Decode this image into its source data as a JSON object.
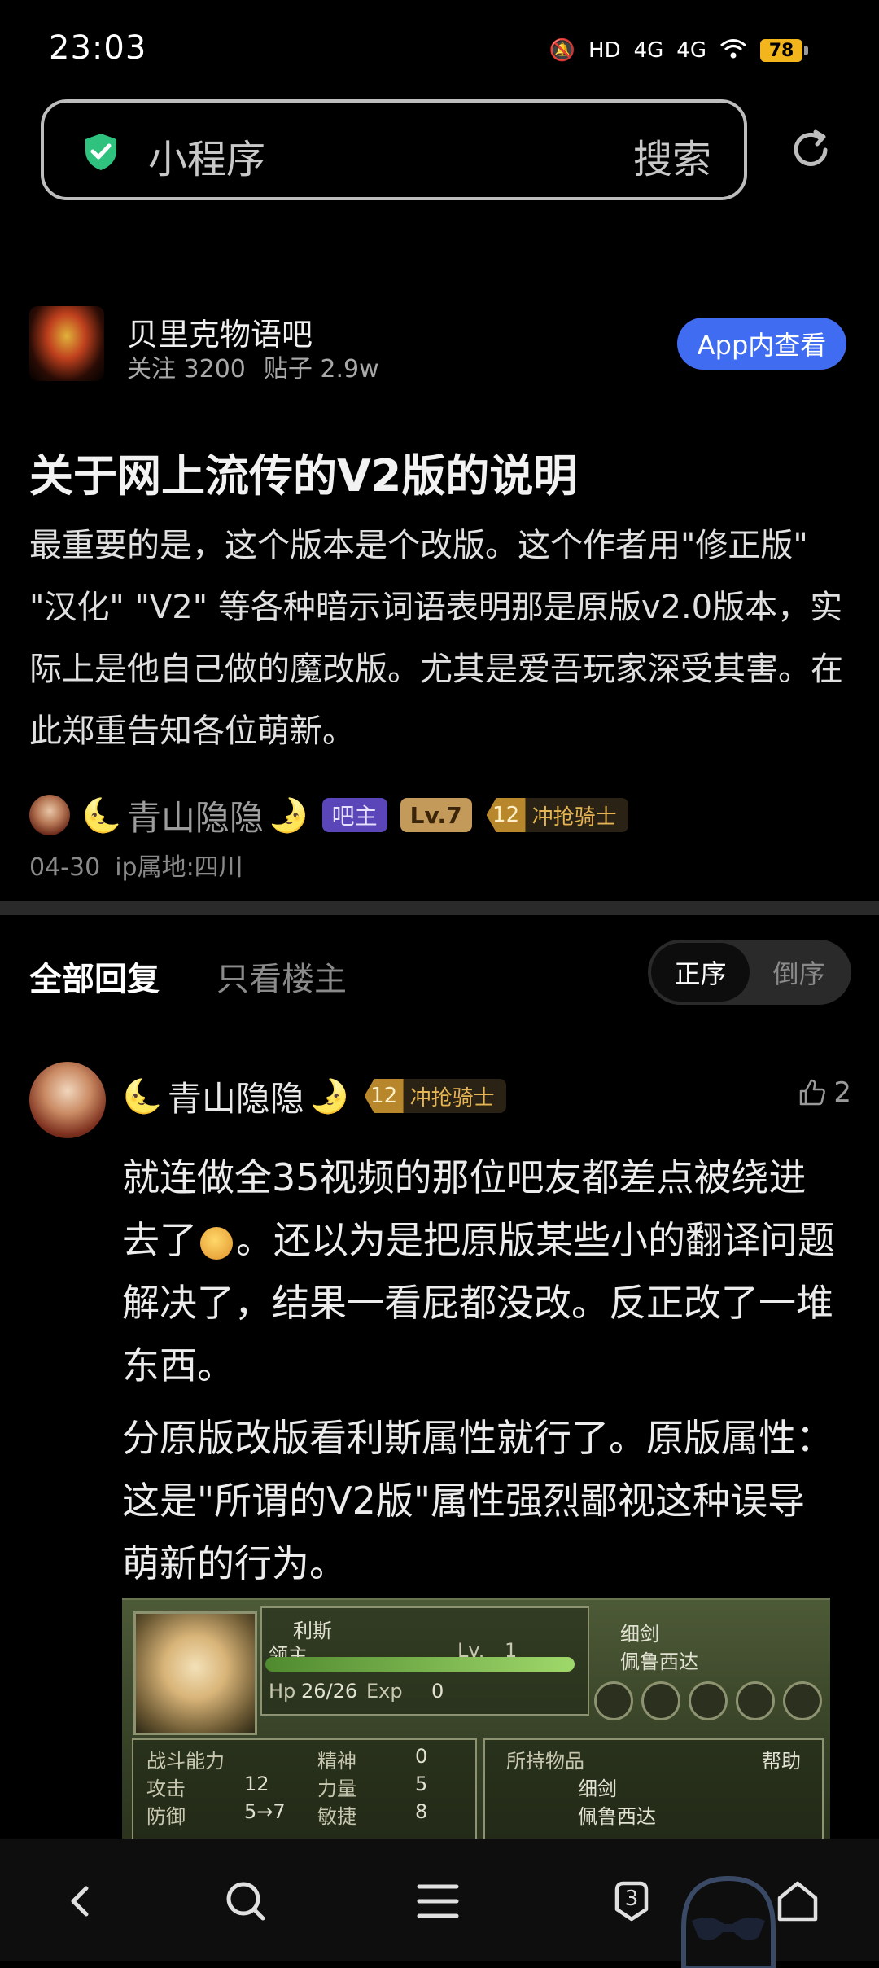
{
  "status_bar": {
    "time": "23:03",
    "network_labels": [
      "HD",
      "4G",
      "4G"
    ],
    "battery": "78"
  },
  "search": {
    "text": "小程序",
    "button": "搜索"
  },
  "forum": {
    "name": "贝里克物语吧",
    "followers": "关注 3200",
    "posts": "贴子 2.9w",
    "app_button": "App内查看"
  },
  "post": {
    "title": "关于网上流传的V2版的说明",
    "body": "最重要的是，这个版本是个改版。这个作者用\"修正版\" \"汉化\" \"V2\" 等各种暗示词语表明那是原版v2.0版本，实际上是他自己做的魔改版。尤其是爱吾玩家深受其害。在此郑重告知各位萌新。",
    "author": {
      "name": "青山隐隐",
      "badge_owner": "吧主",
      "badge_level": "Lv.7",
      "honor_level": "12",
      "honor_title": "冲抢骑士"
    },
    "date": "04-30",
    "ip": "ip属地:四川"
  },
  "replies_header": {
    "tab_all": "全部回复",
    "tab_op_only": "只看楼主",
    "sort_asc": "正序",
    "sort_desc": "倒序"
  },
  "reply": {
    "author": {
      "name": "青山隐隐",
      "honor_level": "12",
      "honor_title": "冲抢骑士"
    },
    "likes": "2",
    "para1_before_emoji": "就连做全35视频的那位吧友都差点被绕进去了",
    "para1_after_emoji": "。还以为是把原版某些小的翻译问题解决了，结果一看屁都没改。反正改了一堆东西。",
    "para2": "分原版改版看利斯属性就行了。原版属性：这是\"所谓的V2版\"属性强烈鄙视这种误导萌新的行为。"
  },
  "game_screenshot": {
    "char_name": "利斯",
    "char_class": "领主",
    "level_label": "Lv.",
    "level_value": "1",
    "hp_label": "Hp",
    "hp_value": "26/26",
    "exp_label": "Exp",
    "exp_value": "0",
    "equip1": "细剑",
    "equip2": "佩鲁西达",
    "stats_header": "战斗能力",
    "stats": [
      {
        "label": "精神",
        "value": "0"
      },
      {
        "label": "攻击",
        "value": "12"
      },
      {
        "label": "力量",
        "value": "5"
      },
      {
        "label": "防御",
        "value": "5→7"
      },
      {
        "label": "敏捷",
        "value": "8"
      }
    ],
    "items_header": "所持物品",
    "help": "帮助",
    "items": [
      "细剑",
      "佩鲁西达"
    ]
  },
  "bottom_nav": {
    "tabs_count": "3"
  },
  "icons": {
    "shield": "shield-check-icon",
    "refresh": "refresh-icon",
    "like": "thumbs-up-icon",
    "back": "chevron-left-icon",
    "search": "search-icon",
    "menu": "menu-icon",
    "tabs": "tabs-icon",
    "home": "home-icon"
  },
  "colors": {
    "accent_blue": "#3f6cf0",
    "shield_green": "#2ec27e",
    "honor_gold": "#e5b453"
  }
}
